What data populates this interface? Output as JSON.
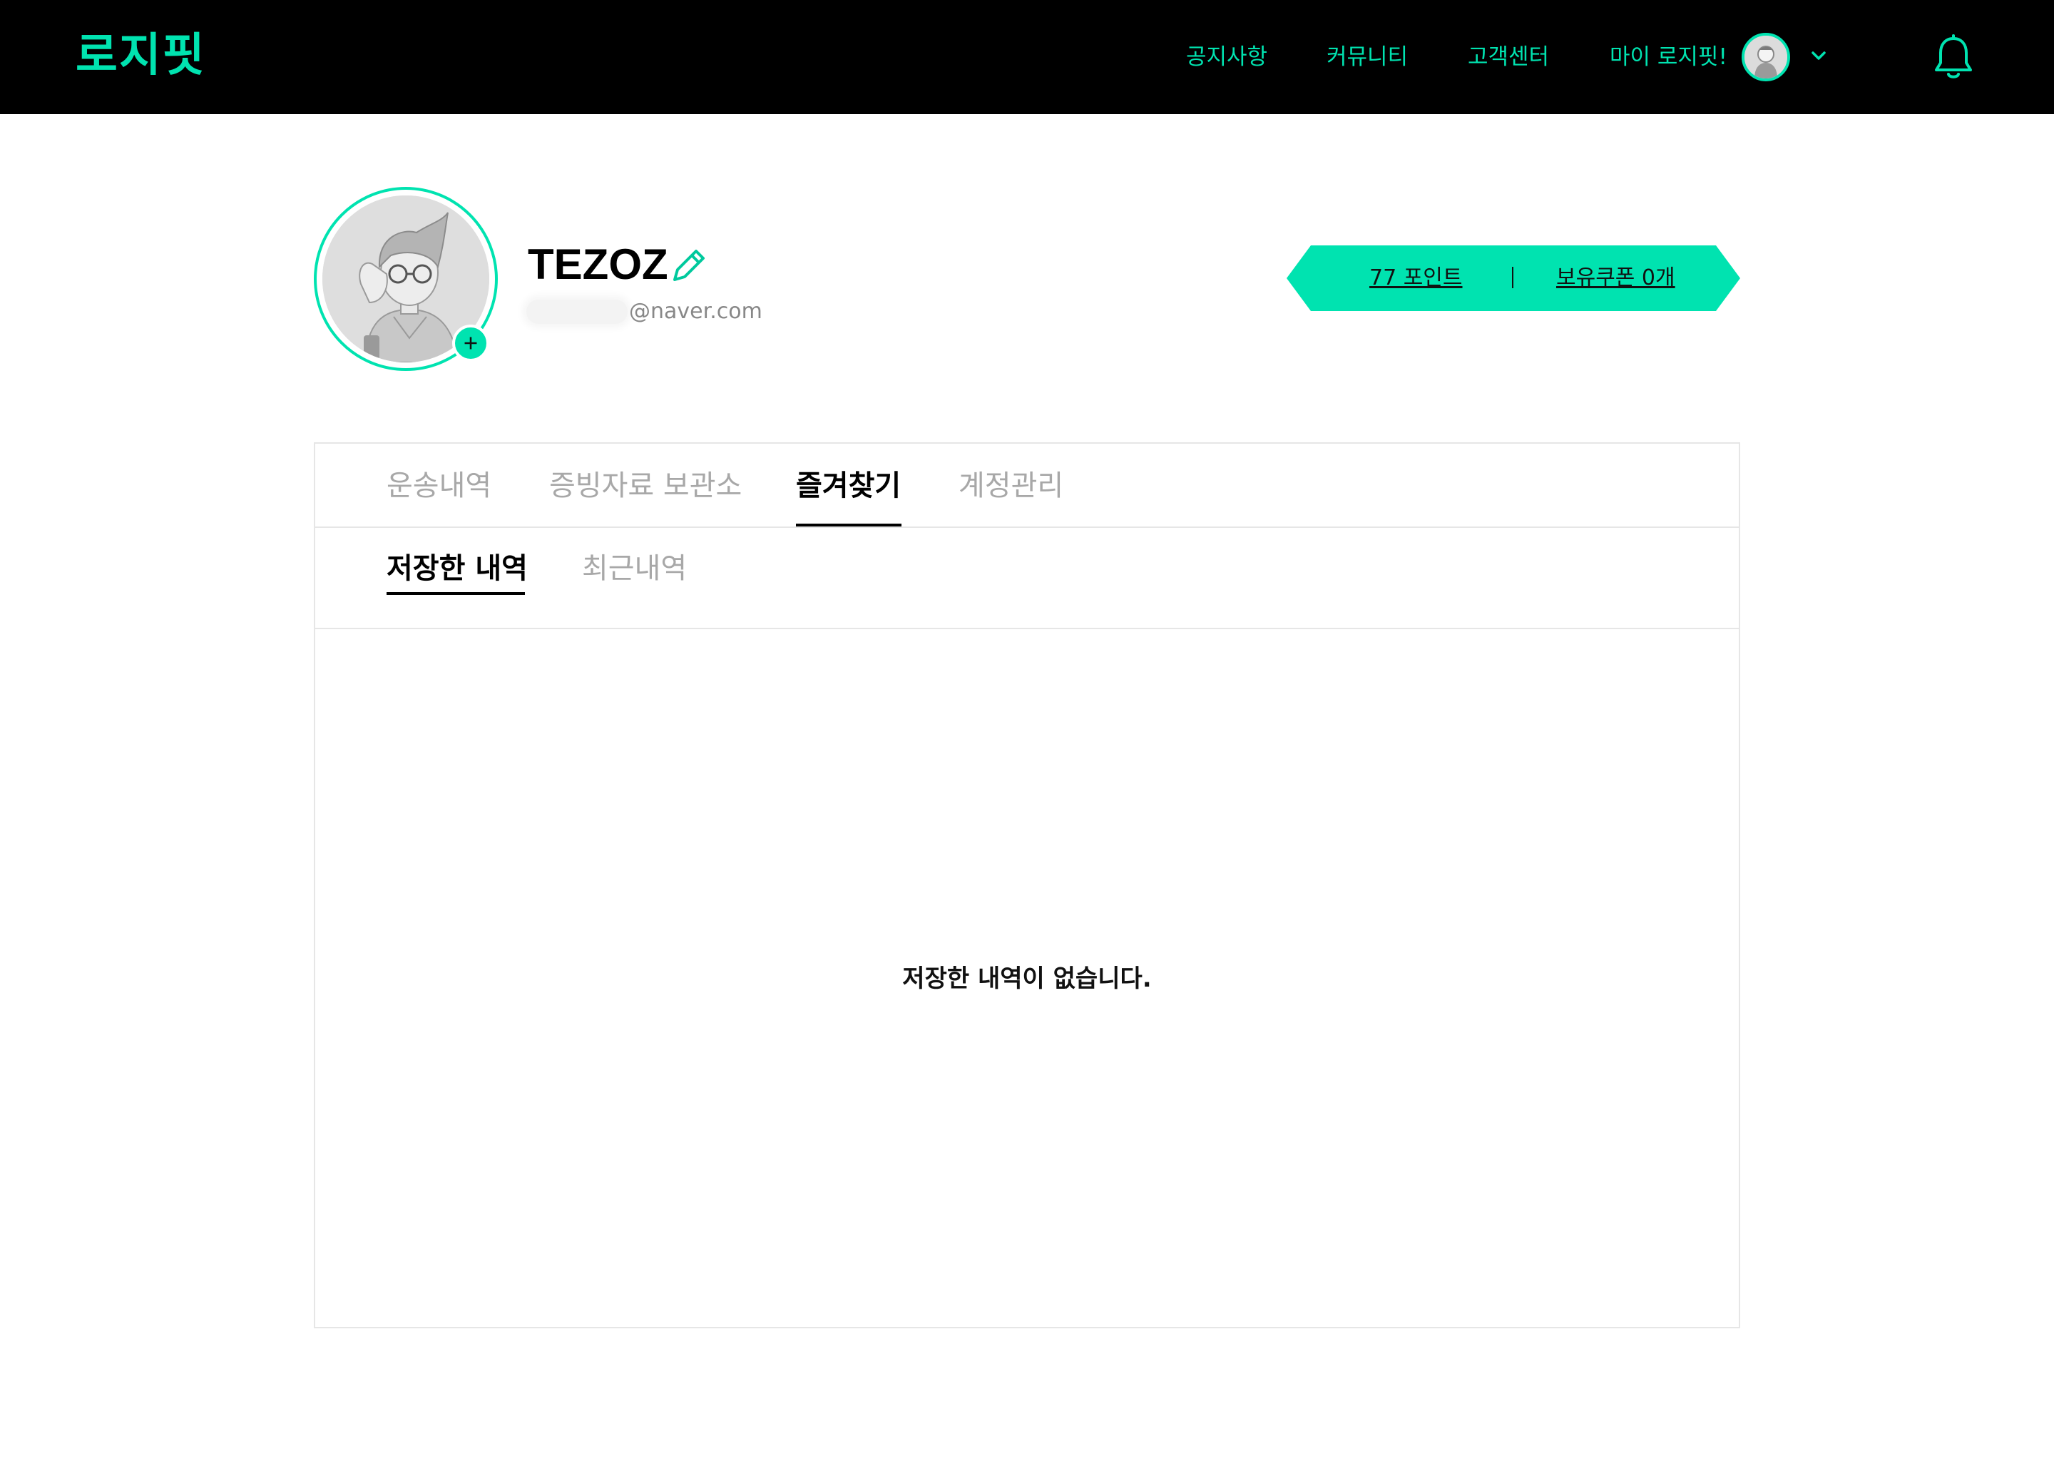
{
  "header": {
    "logo": "로지핏",
    "nav": {
      "notice": "공지사항",
      "community": "커뮤니티",
      "support": "고객센터",
      "my": "마이 로지핏!"
    }
  },
  "profile": {
    "username": "TEZOZ",
    "email_domain": "@naver.com",
    "points": "77 포인트",
    "coupons": "보유쿠폰 0개"
  },
  "tabs": [
    {
      "label": "운송내역",
      "active": false
    },
    {
      "label": "증빙자료 보관소",
      "active": false
    },
    {
      "label": "즐겨찾기",
      "active": true
    },
    {
      "label": "계정관리",
      "active": false
    }
  ],
  "subtabs": [
    {
      "label": "저장한 내역",
      "active": true
    },
    {
      "label": "최근내역",
      "active": false
    }
  ],
  "empty_message": "저장한 내역이 없습니다.",
  "colors": {
    "accent": "#00e3b0",
    "header_bg": "#000000",
    "muted_text": "#a8a8a8",
    "border": "#e6e6e6"
  },
  "icons": [
    "avatar-icon",
    "chevron-down-icon",
    "bell-icon",
    "pencil-icon",
    "plus-icon"
  ]
}
